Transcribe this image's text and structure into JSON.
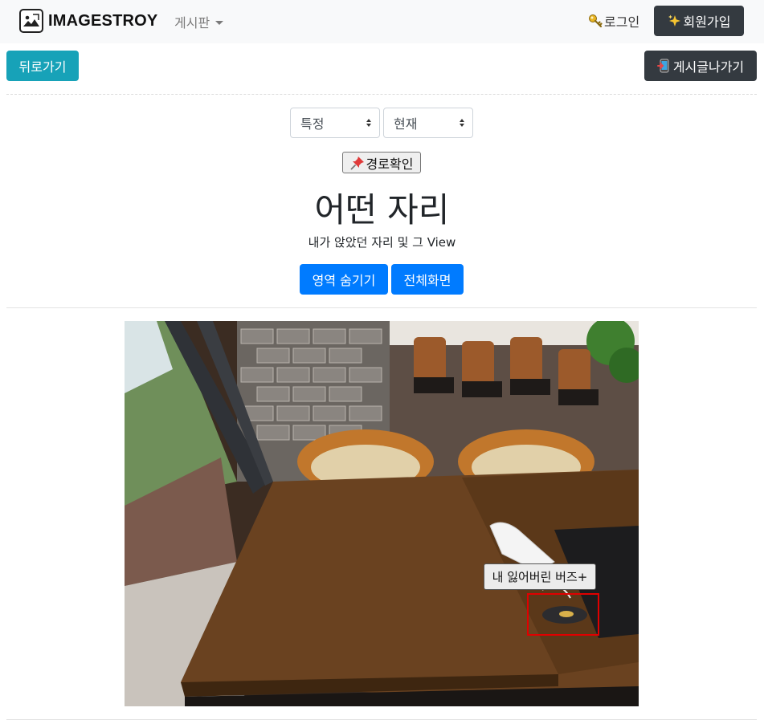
{
  "nav": {
    "brand": "IMAGESTROY",
    "board": "게시판",
    "login": "로그인",
    "signup": "회원가입"
  },
  "actions": {
    "back": "뒤로가기",
    "exit": "게시글나가기"
  },
  "filters": {
    "specific": "특정",
    "current": "현재"
  },
  "path_button": "경로확인",
  "post": {
    "title": "어떤 자리",
    "subtitle": "내가 앉았던 자리 및 그 View"
  },
  "view_buttons": {
    "hide_area": "영역 숨기기",
    "fullscreen": "전체화면"
  },
  "annotation": {
    "label": "내 잃어버린 버즈+"
  },
  "icons": {
    "brand": "image-icon",
    "login": "key-icon",
    "signup": "sparkles-icon",
    "exit": "mobile-exit-icon",
    "path": "pushpin-icon"
  },
  "colors": {
    "navbar_bg": "#f8f9fa",
    "dark_button": "#343a40",
    "info_button": "#17a2b8",
    "primary_button": "#007bff",
    "marker": "#e00000"
  }
}
